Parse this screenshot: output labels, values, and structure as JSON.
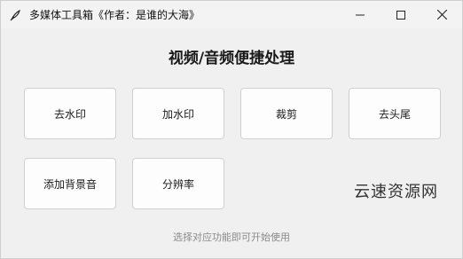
{
  "window": {
    "title": "多媒体工具箱《作者：是谁的大海》",
    "icon": "feather-icon",
    "controls": [
      "minimize-icon",
      "maximize-icon",
      "close-icon"
    ]
  },
  "main": {
    "heading": "视频/音频便捷处理",
    "buttons": [
      {
        "label": "去水印"
      },
      {
        "label": "加水印"
      },
      {
        "label": "裁剪"
      },
      {
        "label": "去头尾"
      },
      {
        "label": "添加背景音"
      },
      {
        "label": "分辨率"
      }
    ],
    "hint": "选择对应功能即可开始使用"
  },
  "watermark": "云速资源网",
  "colors": {
    "background": "#f0f0f0",
    "button_bg": "#fdfdfd",
    "button_border": "#d0d0d0",
    "hint_text": "#8a8a8a"
  }
}
